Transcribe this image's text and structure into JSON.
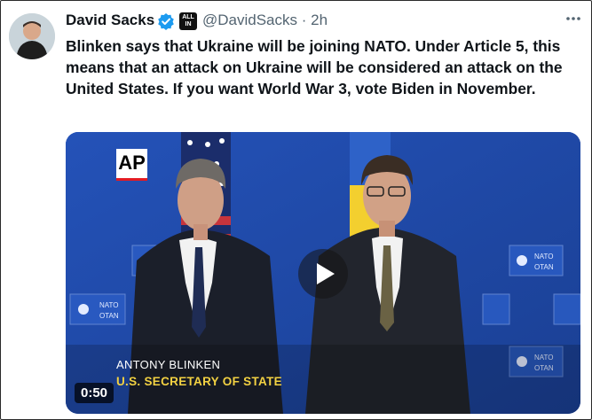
{
  "tweet": {
    "author_name": "David Sacks",
    "badge_text": "ALL IN",
    "handle": "@DavidSacks",
    "time": "· 2h",
    "text": "Blinken says that Ukraine will be joining NATO. Under Article 5, this means that an attack on Ukraine will be considered an attack on the United States. If you want World War 3, vote Biden in November."
  },
  "video": {
    "network_logo": "AP",
    "caption_name": "ANTONY BLINKEN",
    "caption_title": "U.S. SECRETARY OF STATE",
    "duration": "0:50",
    "backdrop_text": "NATO OTAN"
  },
  "icons": {
    "verified": "verified-badge-icon",
    "more": "more-options-icon",
    "play": "play-icon"
  },
  "colors": {
    "verified_blue": "#1d9bf0",
    "text_primary": "#0f1419",
    "text_secondary": "#536471",
    "caption_title": "#f2d142"
  }
}
